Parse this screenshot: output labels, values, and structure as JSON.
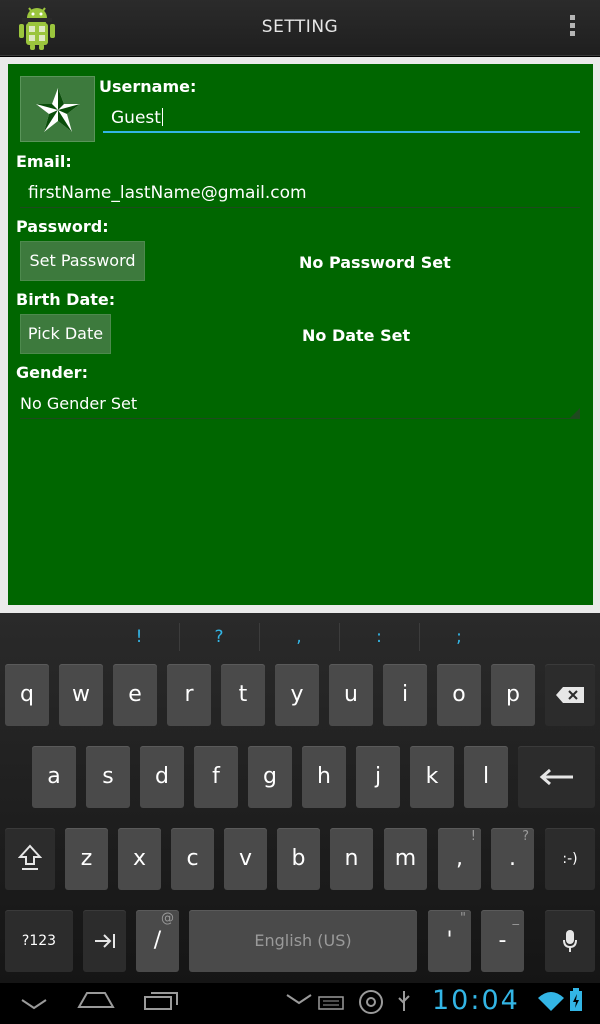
{
  "actionbar": {
    "title": "SETTING"
  },
  "form": {
    "username_label": "Username:",
    "username_value": "Guest",
    "email_label": "Email:",
    "email_value": "firstName_lastName@gmail.com",
    "password_label": "Password:",
    "set_password_button": "Set Password",
    "password_status": "No Password Set",
    "birthdate_label": "Birth Date:",
    "pick_date_button": "Pick Date",
    "date_status": "No Date Set",
    "gender_label": "Gender:",
    "gender_value": "No Gender Set"
  },
  "keyboard": {
    "suggestions": [
      "!",
      "?",
      ",",
      ":",
      ";"
    ],
    "row1": [
      "q",
      "w",
      "e",
      "r",
      "t",
      "y",
      "u",
      "i",
      "o",
      "p"
    ],
    "row2": [
      "a",
      "s",
      "d",
      "f",
      "g",
      "h",
      "j",
      "k",
      "l"
    ],
    "row3": [
      "z",
      "x",
      "c",
      "v",
      "b",
      "n",
      "m"
    ],
    "comma": ",",
    "comma_hint": "!",
    "period": ".",
    "period_hint": "?",
    "smiley": ":-)",
    "symbols_key": "?123",
    "slash": "/",
    "slash_hint": "@",
    "space_label": "English (US)",
    "apostrophe": "'",
    "apostrophe_hint": "\"",
    "dash": "-",
    "dash_hint": "_"
  },
  "statusbar": {
    "clock": "10:04"
  },
  "colors": {
    "panel": "#006600",
    "accent": "#33b5e5"
  },
  "icons": [
    "android-app-icon",
    "overflow-menu-icon",
    "star-avatar-icon",
    "backspace-icon",
    "enter-icon",
    "shift-icon",
    "tab-icon",
    "mic-icon",
    "back-icon",
    "home-icon",
    "recent-apps-icon",
    "keyboard-icon",
    "usb-icon",
    "wifi-icon",
    "battery-icon"
  ]
}
